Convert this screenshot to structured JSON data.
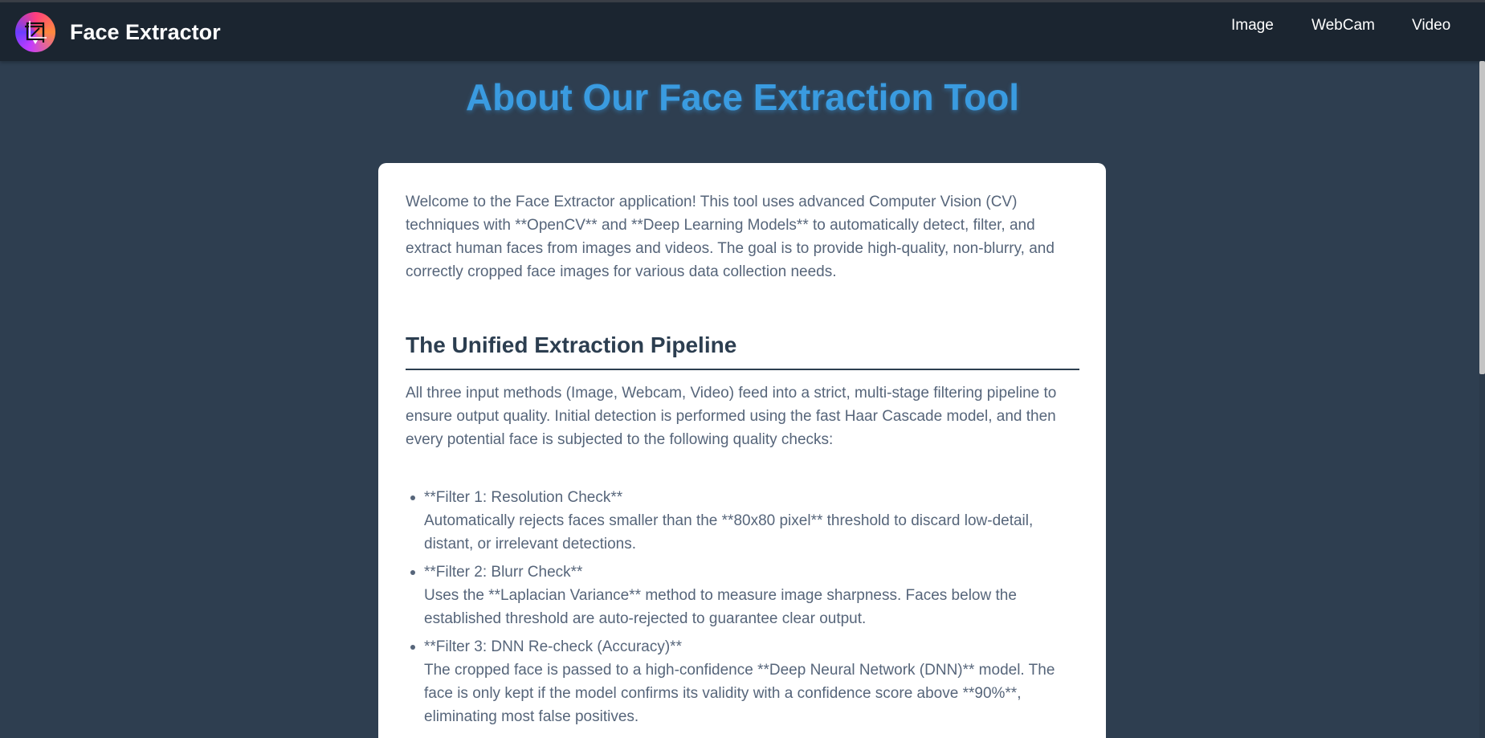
{
  "navbar": {
    "brand": "Face Extractor",
    "links": [
      {
        "label": "Image"
      },
      {
        "label": "WebCam"
      },
      {
        "label": "Video"
      }
    ]
  },
  "main": {
    "title": "About Our Face Extraction Tool",
    "intro": "Welcome to the Face Extractor application! This tool uses advanced Computer Vision (CV) techniques with **OpenCV** and **Deep Learning Models** to automatically detect, filter, and extract human faces from images and videos. The goal is to provide high-quality, non-blurry, and correctly cropped face images for various data collection needs.",
    "pipeline": {
      "heading": "The Unified Extraction Pipeline",
      "text": "All three input methods (Image, Webcam, Video) feed into a strict, multi-stage filtering pipeline to ensure output quality. Initial detection is performed using the fast Haar Cascade model, and then every potential face is subjected to the following quality checks:",
      "filters": [
        {
          "title": "**Filter 1: Resolution Check**",
          "description": "Automatically rejects faces smaller than the **80x80 pixel** threshold to discard low-detail, distant, or irrelevant detections."
        },
        {
          "title": "**Filter 2: Blurr Check**",
          "description": "Uses the **Laplacian Variance** method to measure image sharpness. Faces below the established threshold are auto-rejected to guarantee clear output."
        },
        {
          "title": "**Filter 3: DNN Re-check (Accuracy)**",
          "description": "The cropped face is passed to a high-confidence **Deep Neural Network (DNN)** model. The face is only kept if the model confirms its validity with a confidence score above **90%**, eliminating most false positives."
        }
      ]
    }
  }
}
